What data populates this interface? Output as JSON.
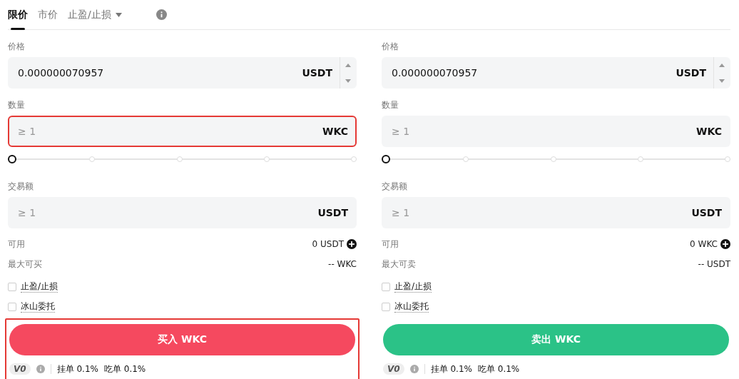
{
  "tabs": [
    {
      "label": "限价",
      "selected": true,
      "dropdown": false
    },
    {
      "label": "市价",
      "selected": false,
      "dropdown": false
    },
    {
      "label": "止盈/止损",
      "selected": false,
      "dropdown": true
    }
  ],
  "panels": [
    {
      "fields": [
        {
          "kind": "input",
          "label": "价格",
          "value": "0.000000070957",
          "unit": "USDT",
          "stepper": true,
          "highlighted": false
        },
        {
          "kind": "input",
          "label": "数量",
          "placeholder": "≥ 1",
          "unit": "WKC",
          "stepper": false,
          "highlighted": true
        },
        {
          "kind": "slider",
          "level": 0
        },
        {
          "kind": "input",
          "label": "交易额",
          "placeholder": "≥ 1",
          "unit": "USDT",
          "stepper": false,
          "highlighted": false
        }
      ],
      "stats": [
        {
          "label": "可用",
          "value": "0 USDT",
          "add": true
        },
        {
          "label": "最大可买",
          "value": "-- WKC",
          "add": false
        }
      ],
      "options": [
        {
          "label": "止盈/止损",
          "checked": false
        },
        {
          "label": "冰山委托",
          "checked": false
        }
      ],
      "action": {
        "label": "买入 WKC",
        "color": "#f5495f"
      },
      "tier": "V0",
      "fees": [
        "挂单 0.1%",
        "吃单 0.1%"
      ],
      "highlighted": true
    },
    {
      "fields": [
        {
          "kind": "input",
          "label": "价格",
          "value": "0.000000070957",
          "unit": "USDT",
          "stepper": true,
          "highlighted": false
        },
        {
          "kind": "input",
          "label": "数量",
          "placeholder": "≥ 1",
          "unit": "WKC",
          "stepper": false,
          "highlighted": false
        },
        {
          "kind": "slider",
          "level": 0
        },
        {
          "kind": "input",
          "label": "交易额",
          "placeholder": "≥ 1",
          "unit": "USDT",
          "stepper": false,
          "highlighted": false
        }
      ],
      "stats": [
        {
          "label": "可用",
          "value": "0 WKC",
          "add": true
        },
        {
          "label": "最大可卖",
          "value": "-- USDT",
          "add": false
        }
      ],
      "options": [
        {
          "label": "止盈/止损",
          "checked": false
        },
        {
          "label": "冰山委托",
          "checked": false
        }
      ],
      "action": {
        "label": "卖出 WKC",
        "color": "#2bc287"
      },
      "tier": "V0",
      "fees": [
        "挂单 0.1%",
        "吃单 0.1%"
      ],
      "highlighted": false
    }
  ]
}
